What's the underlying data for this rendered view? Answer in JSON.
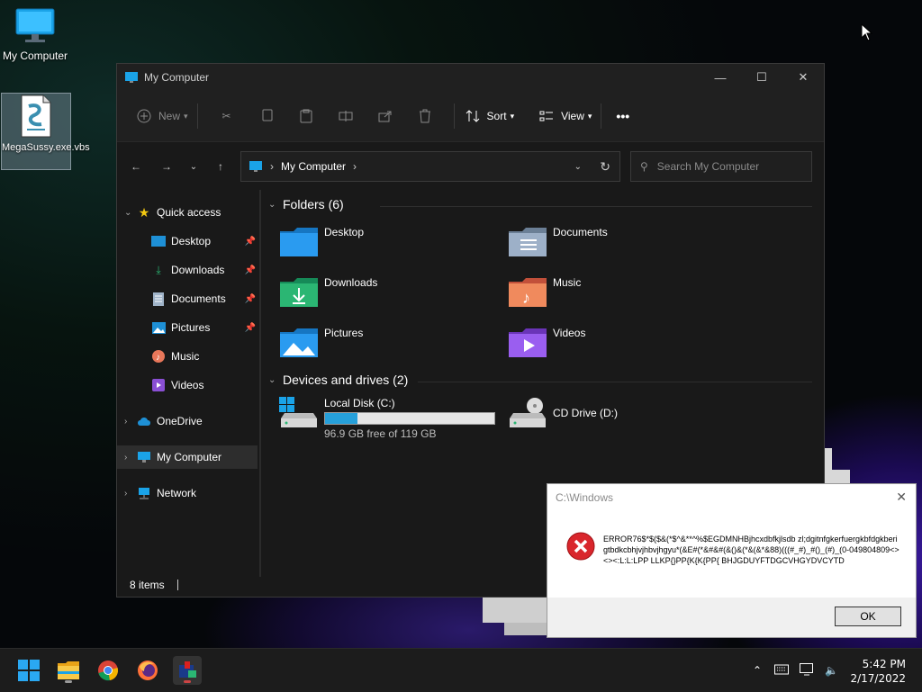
{
  "desktop": {
    "icons": [
      {
        "label": "My Computer"
      },
      {
        "label": "MegaSussy.exe.vbs"
      }
    ]
  },
  "explorer": {
    "title": "My Computer",
    "toolbar": {
      "new_label": "New",
      "sort_label": "Sort",
      "view_label": "View",
      "more_label": "•••"
    },
    "address": {
      "path": "My Computer"
    },
    "search": {
      "placeholder": "Search My Computer"
    },
    "sidebar": {
      "quick_access": "Quick access",
      "items": [
        {
          "label": "Desktop"
        },
        {
          "label": "Downloads"
        },
        {
          "label": "Documents"
        },
        {
          "label": "Pictures"
        },
        {
          "label": "Music"
        },
        {
          "label": "Videos"
        }
      ],
      "onedrive": "OneDrive",
      "my_computer": "My Computer",
      "network": "Network"
    },
    "folders_header": "Folders (6)",
    "folders": [
      {
        "label": "Desktop"
      },
      {
        "label": "Documents"
      },
      {
        "label": "Downloads"
      },
      {
        "label": "Music"
      },
      {
        "label": "Pictures"
      },
      {
        "label": "Videos"
      }
    ],
    "drives_header": "Devices and drives (2)",
    "drives": [
      {
        "label": "Local Disk (C:)",
        "free_text": "96.9 GB free of 119 GB",
        "used_fraction": 0.19
      },
      {
        "label": "CD Drive (D:)"
      }
    ],
    "status": {
      "items": "8 items"
    }
  },
  "dialog": {
    "title": "C:\\Windows",
    "message": "ERROR76$*$($&(*$^&**^%$EGDMNHBjhcxdbfkjlsdb zl;dgitnfgkerfuergkbfdgkberigtbdkcbhjvjhbvjhgyu*(&E#(*&#&#(&()&(*&(&*&88)(((#_#)_#()_(#)_(0-049804809<><><:L:L:LPP LLKP{}PP{K{K{PP{ BHJGDUYFTDGCVHGYDVCYTD",
    "ok_label": "OK"
  },
  "taskbar": {
    "time": "5:42 PM",
    "date": "2/17/2022"
  },
  "colors": {
    "accent": "#26a0da",
    "error_red": "#d9262c",
    "window_bg": "#191919"
  }
}
